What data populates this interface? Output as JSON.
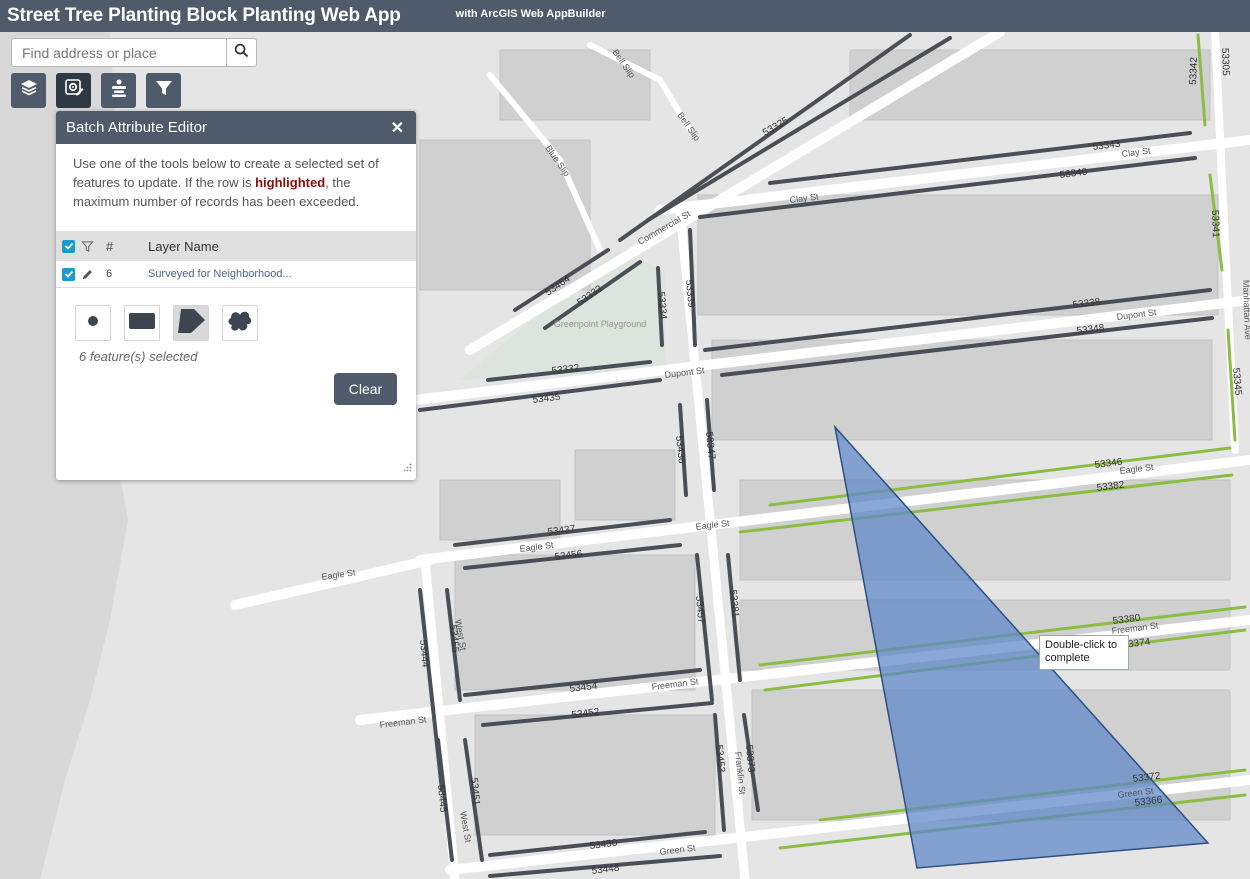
{
  "header": {
    "title": "Street Tree Planting Block Planting Web App",
    "subtitle": "with ArcGIS Web AppBuilder"
  },
  "search": {
    "placeholder": "Find address or place",
    "icon": "search-icon"
  },
  "toolbar": {
    "buttons": [
      {
        "icon": "layers-icon"
      },
      {
        "icon": "batch-edit-icon"
      },
      {
        "icon": "attribute-table-icon"
      },
      {
        "icon": "filter-icon"
      }
    ]
  },
  "panel": {
    "title": "Batch Attribute Editor",
    "desc_pre": "Use one of the tools below to create a selected set of features to update. If the row is ",
    "desc_highlight": "highlighted",
    "desc_post": ", the maximum number of records has been exceeded.",
    "table_header": {
      "num": "#",
      "name": "Layer Name"
    },
    "rows": [
      {
        "count": "6",
        "name": "Surveyed for Neighborhood..."
      }
    ],
    "selection_tools": [
      "point-select-icon",
      "rectangle-select-icon",
      "polygon-select-icon",
      "freehand-select-icon"
    ],
    "selected_text": "6 feature(s) selected",
    "clear_label": "Clear"
  },
  "map": {
    "tooltip": "Double-click to complete",
    "streets": [
      "Bell Slip",
      "Blue Slip",
      "Commercial St",
      "Clay St",
      "Dupont St",
      "Eagle St",
      "Freeman St",
      "Green St",
      "West St",
      "Franklin St",
      "Manhattan Ave"
    ],
    "places": [
      "Greenpoint Playground"
    ],
    "segment_ids": [
      "53325",
      "53343",
      "53340",
      "53305",
      "53342",
      "53341",
      "53464",
      "53333",
      "53339",
      "53334",
      "53338",
      "53348",
      "53332",
      "53345",
      "53435",
      "53436",
      "53347",
      "53346",
      "53382",
      "53437",
      "53456",
      "53444",
      "53455",
      "53457",
      "53381",
      "53380",
      "53374",
      "53454",
      "53452",
      "53453",
      "53373",
      "53445",
      "53451",
      "53372",
      "53366",
      "53450",
      "53448"
    ],
    "colors": {
      "segment_surveyed": "#4a4f57",
      "segment_green": "#8bbd45",
      "selection_fill": "#5b87c7",
      "selection_stroke": "#2e4f82",
      "water": "#d9d9d9"
    }
  }
}
